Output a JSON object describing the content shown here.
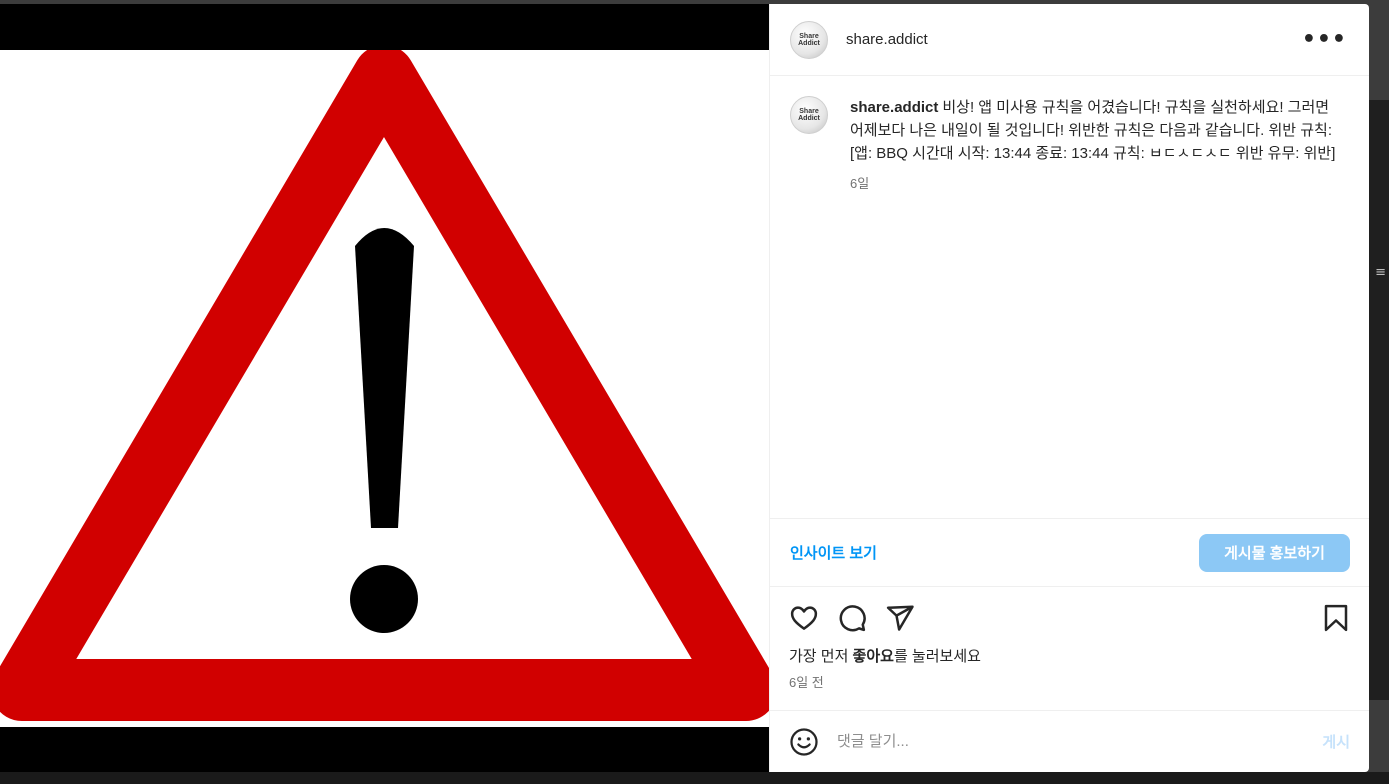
{
  "post": {
    "username": "share.addict",
    "avatar_text_line1": "Share",
    "avatar_text_line2": "Addict",
    "more_label": "•••",
    "image_icon": "warning-triangle-exclamation"
  },
  "caption": {
    "username": "share.addict",
    "text": "비상! 앱 미사용 규칙을 어겼습니다! 규칙을 실천하세요! 그러면 어제보다 나은 내일이 될 것입니다! 위반한 규칙은 다음과 같습니다. 위반 규칙: [앱: BBQ 시간대 시작: 13:44 종료: 13:44 규칙: ㅂㄷㅅㄷㅅㄷ 위반 유무: 위반]",
    "time": "6일"
  },
  "insight": {
    "view_insights_label": "인사이트 보기",
    "promote_label": "게시물 홍보하기"
  },
  "actions": {
    "like_icon": "heart-icon",
    "comment_icon": "comment-icon",
    "share_icon": "paper-plane-icon",
    "save_icon": "bookmark-icon",
    "likes_prefix": "가장 먼저 ",
    "likes_bold": "좋아요",
    "likes_suffix": "를 눌러보세요",
    "age": "6일 전"
  },
  "comment": {
    "placeholder": "댓글 달기...",
    "post_label": "게시",
    "emoji_icon": "smiley-icon"
  },
  "colors": {
    "accent": "#0095f6",
    "promote_bg": "#8cc8f5",
    "warning_red": "#d10000"
  }
}
